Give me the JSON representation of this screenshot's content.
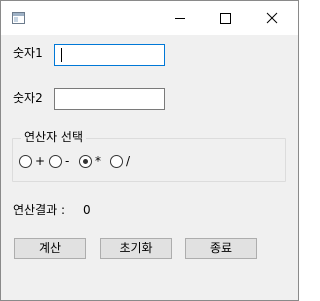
{
  "window": {
    "title": "",
    "icon": "app-window-icon",
    "controls": {
      "minimize": "minimize-icon",
      "maximize": "maximize-icon",
      "close": "close-icon"
    }
  },
  "form": {
    "number1": {
      "label": "숫자1",
      "value": "",
      "focused": true
    },
    "number2": {
      "label": "숫자2",
      "value": ""
    },
    "operator_group": {
      "title": "연산자 선택",
      "options": [
        {
          "label": "+",
          "checked": false
        },
        {
          "label": "-",
          "checked": false
        },
        {
          "label": "*",
          "checked": true
        },
        {
          "label": "/",
          "checked": false
        }
      ]
    },
    "result": {
      "label": "연산결과 :",
      "value": "0"
    }
  },
  "buttons": {
    "calculate": "계산",
    "reset": "초기화",
    "exit": "종료"
  },
  "colors": {
    "window_bg": "#f0f0f0",
    "titlebar_bg": "#ffffff",
    "focus_border": "#0078d7",
    "button_bg": "#e1e1e1",
    "button_border": "#adadad"
  }
}
